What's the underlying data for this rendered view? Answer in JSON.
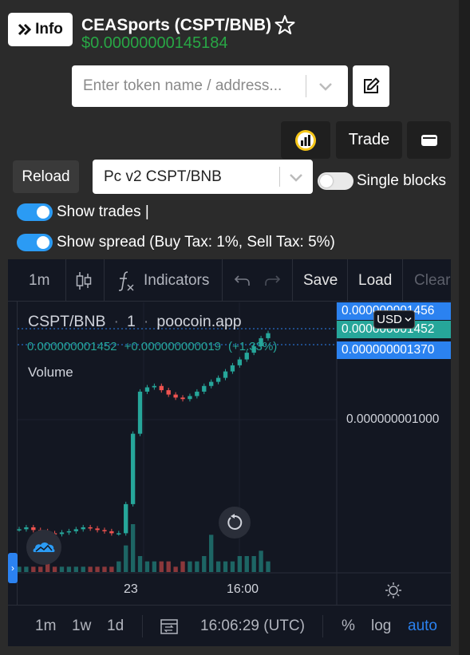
{
  "header": {
    "info_label": "Info",
    "title": "CEASports (CSPT/BNB)",
    "price": "$0.00000000145184"
  },
  "search": {
    "placeholder": "Enter token name / address..."
  },
  "toolbar": {
    "trade_label": "Trade"
  },
  "controls": {
    "reload_label": "Reload",
    "pair_selected": "Pc v2 CSPT/BNB",
    "single_blocks_label": "Single blocks",
    "single_blocks_on": false,
    "show_trades_label": "Show trades |",
    "show_trades_on": true,
    "show_spread_label": "Show spread (Buy Tax: 1%, Sell Tax: 5%)",
    "show_spread_on": true
  },
  "chart_toolbar": {
    "interval": "1m",
    "indicators_label": "Indicators",
    "save_label": "Save",
    "load_label": "Load",
    "clear_label": "Clear"
  },
  "chart_legend": {
    "symbol": "CSPT/BNB",
    "interval": "1",
    "source": "poocoin.app",
    "last_price": "0.000000001452",
    "change": "+0.000000000019",
    "change_pct": "(+1.33%)",
    "volume_label": "Volume"
  },
  "price_axis": {
    "tag_top": "0.000000001456",
    "tag_mid": "0.000000001452",
    "tag_low": "0.000000001370",
    "tick_1": "0.000000001000",
    "currency": "USD"
  },
  "time_axis": {
    "tick_1": "23",
    "tick_2": "16:00"
  },
  "bottom_bar": {
    "range_1m": "1m",
    "range_1w": "1w",
    "range_1d": "1d",
    "clock": "16:06:29 (UTC)",
    "percent": "%",
    "log": "log",
    "auto": "auto"
  },
  "colors": {
    "up": "#26a69a",
    "down": "#ef5350",
    "price_green": "#28a745",
    "accent_blue": "#2b9bf4",
    "tag_blue": "#2b82f0",
    "tag_teal": "#26a69a"
  },
  "chart_data": {
    "type": "candlestick",
    "title": "CSPT/BNB",
    "currency": "USD",
    "price_ticks": [
      "0.000000001000"
    ],
    "time_ticks": [
      "23",
      "16:00"
    ],
    "series": [
      {
        "name": "price",
        "close": [
          3.5e-10,
          3.55e-10,
          3.48e-10,
          3.45e-10,
          3.4e-10,
          3.38e-10,
          3.42e-10,
          3.45e-10,
          3.5e-10,
          3.55e-10,
          3.52e-10,
          3.48e-10,
          3.45e-10,
          3.4e-10,
          3.4e-10,
          4.2e-10,
          7e-10,
          9.5e-10,
          9.8e-10,
          9.9e-10,
          9.6e-10,
          9.3e-10,
          9.1e-10,
          9e-10,
          9.2e-10,
          9.5e-10,
          9.9e-10,
          1.02e-09,
          1.05e-09,
          1.1e-09,
          1.15e-09,
          1.2e-09,
          1.26e-09,
          1.32e-09,
          1.4e-09,
          1.452e-09
        ]
      },
      {
        "name": "Volume",
        "values": [
          1,
          1,
          1,
          1,
          2,
          1,
          1,
          1,
          1,
          1,
          1,
          1,
          1,
          1,
          2,
          5,
          9,
          3,
          2,
          2,
          2,
          2,
          1,
          2,
          2,
          2,
          3,
          7,
          2,
          2,
          2,
          3,
          3,
          3,
          4,
          2
        ]
      }
    ]
  }
}
